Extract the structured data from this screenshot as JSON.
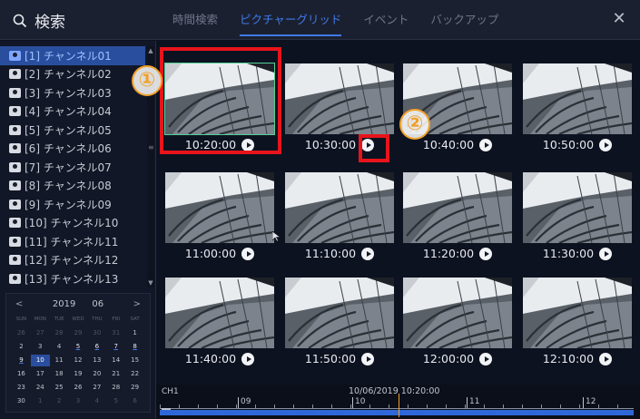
{
  "header": {
    "title": "検索",
    "tabs": [
      {
        "label": "時間検索",
        "active": false
      },
      {
        "label": "ピクチャーグリッド",
        "active": true
      },
      {
        "label": "イベント",
        "active": false
      },
      {
        "label": "バックアップ",
        "active": false
      }
    ],
    "close_label": "✕"
  },
  "sidebar": {
    "channels": [
      "[1] チャンネル01",
      "[2] チャンネル02",
      "[3] チャンネル03",
      "[4] チャンネル04",
      "[5] チャンネル05",
      "[6] チャンネル06",
      "[7] チャンネル07",
      "[8] チャンネル08",
      "[9] チャンネル09",
      "[10] チャンネル10",
      "[11] チャンネル11",
      "[12] チャンネル12",
      "[13] チャンネル13"
    ],
    "selected_index": 0
  },
  "calendar": {
    "prev": "<",
    "next": ">",
    "year": "2019",
    "month": "06",
    "weekdays": [
      "SUN",
      "MON",
      "TUE",
      "WED",
      "THU",
      "FRI",
      "SAT"
    ],
    "days": [
      {
        "d": "26",
        "state": "muted"
      },
      {
        "d": "27",
        "state": "muted"
      },
      {
        "d": "28",
        "state": "muted"
      },
      {
        "d": "29",
        "state": "muted"
      },
      {
        "d": "30",
        "state": "muted"
      },
      {
        "d": "31",
        "state": "muted"
      },
      {
        "d": "1",
        "state": "normal"
      },
      {
        "d": "2",
        "state": "normal"
      },
      {
        "d": "3",
        "state": "normal"
      },
      {
        "d": "4",
        "state": "normal"
      },
      {
        "d": "5",
        "state": "has-rec"
      },
      {
        "d": "6",
        "state": "has-rec"
      },
      {
        "d": "7",
        "state": "has-rec"
      },
      {
        "d": "8",
        "state": "has-rec"
      },
      {
        "d": "9",
        "state": "has-rec"
      },
      {
        "d": "10",
        "state": "today"
      },
      {
        "d": "11",
        "state": "normal"
      },
      {
        "d": "12",
        "state": "normal"
      },
      {
        "d": "13",
        "state": "normal"
      },
      {
        "d": "14",
        "state": "normal"
      },
      {
        "d": "15",
        "state": "normal"
      },
      {
        "d": "16",
        "state": "normal"
      },
      {
        "d": "17",
        "state": "normal"
      },
      {
        "d": "18",
        "state": "normal"
      },
      {
        "d": "19",
        "state": "normal"
      },
      {
        "d": "20",
        "state": "normal"
      },
      {
        "d": "21",
        "state": "normal"
      },
      {
        "d": "22",
        "state": "normal"
      },
      {
        "d": "23",
        "state": "normal"
      },
      {
        "d": "24",
        "state": "normal"
      },
      {
        "d": "25",
        "state": "normal"
      },
      {
        "d": "26",
        "state": "normal"
      },
      {
        "d": "27",
        "state": "normal"
      },
      {
        "d": "28",
        "state": "normal"
      },
      {
        "d": "29",
        "state": "normal"
      },
      {
        "d": "30",
        "state": "normal"
      },
      {
        "d": "1",
        "state": "muted"
      },
      {
        "d": "2",
        "state": "muted"
      },
      {
        "d": "3",
        "state": "muted"
      },
      {
        "d": "4",
        "state": "muted"
      },
      {
        "d": "5",
        "state": "muted"
      },
      {
        "d": "6",
        "state": "muted"
      }
    ]
  },
  "grid": {
    "thumbnails": [
      "10:20:00",
      "10:30:00",
      "10:40:00",
      "10:50:00",
      "11:00:00",
      "11:10:00",
      "11:20:00",
      "11:30:00",
      "11:40:00",
      "11:50:00",
      "12:00:00",
      "12:10:00"
    ],
    "selected_index": 0
  },
  "annotations": {
    "marker_1": "①",
    "marker_2": "②",
    "color": "#e8141b"
  },
  "timeline": {
    "channel": "CH1",
    "timestamp": "10/06/2019 10:20:00",
    "hours": [
      "09",
      "10",
      "11",
      "12"
    ]
  },
  "colors": {
    "accent": "#3f7ae8",
    "selection_bg": "#2a4e9e",
    "record_bar": "#2f67d8",
    "cursor": "#f0a12a"
  }
}
